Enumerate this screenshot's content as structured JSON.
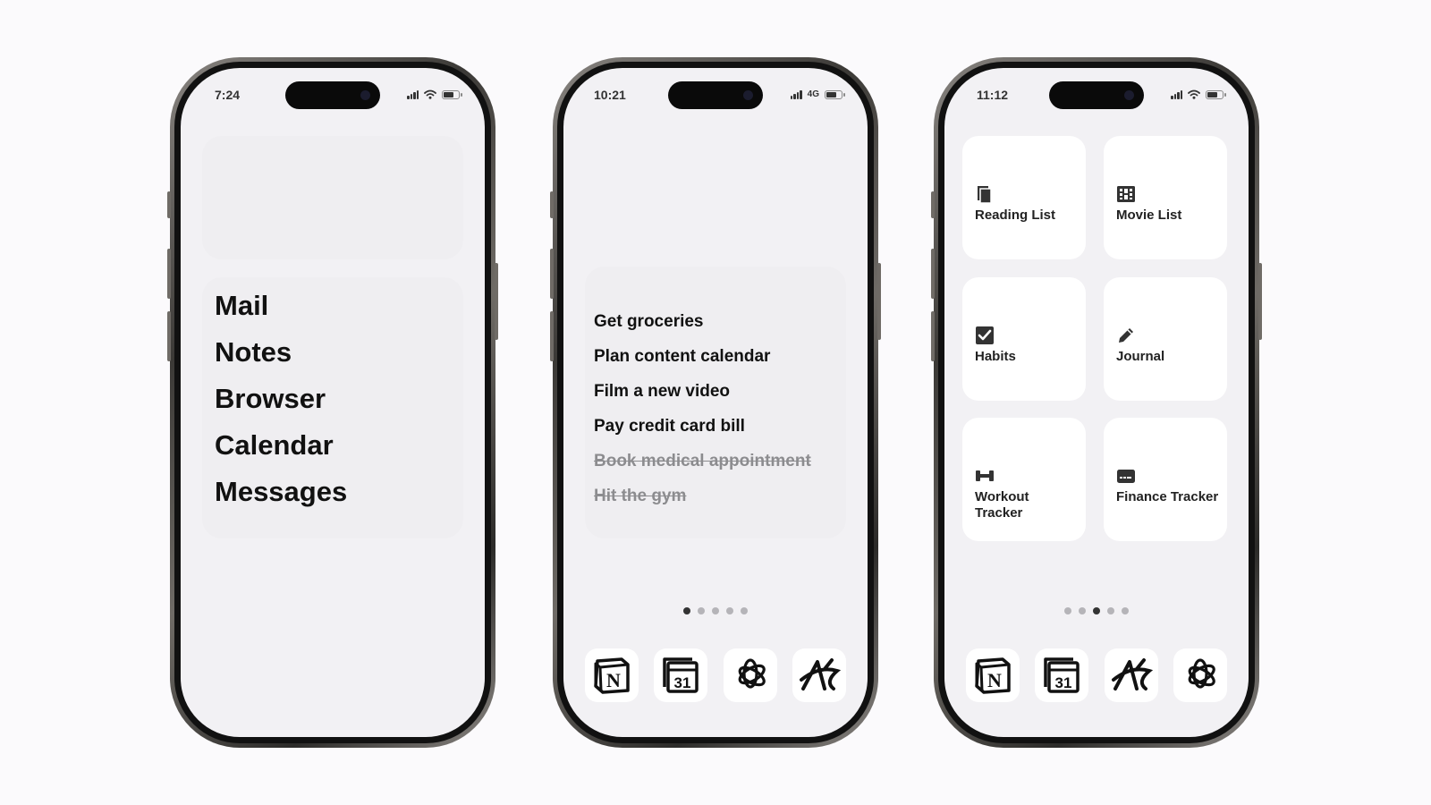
{
  "phone_left": {
    "time": "7:24",
    "apps": [
      "Mail",
      "Notes",
      "Browser",
      "Calendar",
      "Messages"
    ]
  },
  "phone_middle": {
    "time": "10:21",
    "network": "4G",
    "todos": [
      {
        "text": "Get groceries",
        "done": false
      },
      {
        "text": "Plan content calendar",
        "done": false
      },
      {
        "text": "Film a new video",
        "done": false
      },
      {
        "text": "Pay credit card bill",
        "done": false
      },
      {
        "text": "Book medical appointment",
        "done": true
      },
      {
        "text": "Hit the gym",
        "done": true
      }
    ],
    "page_dots": {
      "count": 5,
      "active": 1
    },
    "dock": [
      "notion-icon",
      "calendar-31-icon",
      "openai-icon",
      "craft-a-icon"
    ]
  },
  "phone_right": {
    "time": "11:12",
    "tiles": [
      {
        "label": "Reading List",
        "icon": "book-icon"
      },
      {
        "label": "Movie List",
        "icon": "film-icon"
      },
      {
        "label": "Habits",
        "icon": "checkbox-icon"
      },
      {
        "label": "Journal",
        "icon": "pencil-icon"
      },
      {
        "label": "Workout Tracker",
        "icon": "dumbbell-icon"
      },
      {
        "label": "Finance Tracker",
        "icon": "credit-card-icon"
      }
    ],
    "page_dots": {
      "count": 5,
      "active": 3
    },
    "dock": [
      "notion-icon",
      "calendar-31-icon",
      "craft-a-icon",
      "openai-icon"
    ],
    "calendar_day": "31"
  }
}
